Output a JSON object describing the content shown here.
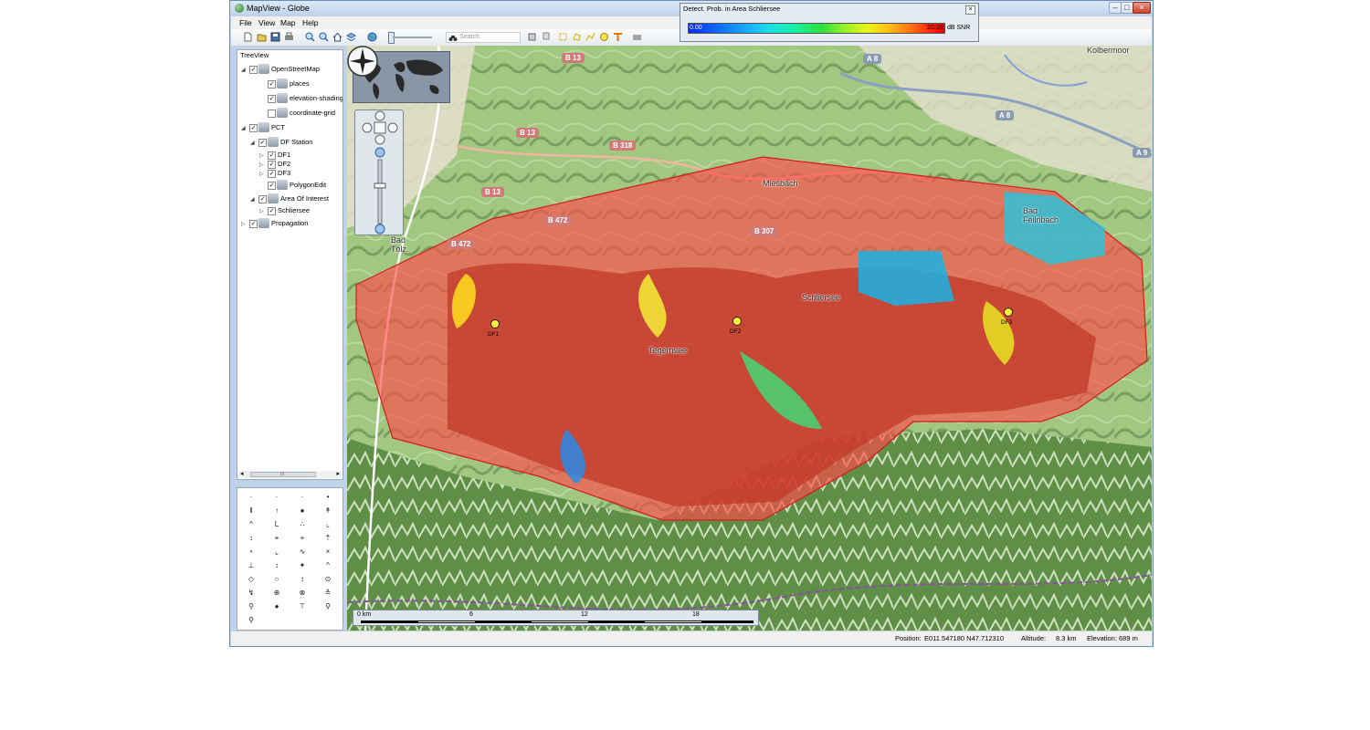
{
  "window": {
    "title": "MapView - Globe",
    "minimize": "–",
    "maximize": "□",
    "close": "×"
  },
  "menu": [
    "File",
    "View",
    "Map",
    "Help"
  ],
  "toolbar": {
    "search_placeholder": "Search"
  },
  "legend": {
    "title": "Detect. Prob. in Area Schliersee",
    "min": "0.00",
    "max": "20.00",
    "unit": "dB SNR",
    "close": "×"
  },
  "tree": {
    "title": "TreeView",
    "items": [
      {
        "label": "OpenStreetMap",
        "checked": true,
        "expander": "◢"
      },
      {
        "label": "places",
        "checked": true
      },
      {
        "label": "elevation-shading",
        "checked": true
      },
      {
        "label": "coordinate-grid",
        "checked": false
      },
      {
        "label": "PCT",
        "checked": true,
        "expander": "◢"
      },
      {
        "label": "DF Station",
        "checked": true,
        "expander": "◢"
      },
      {
        "label": "DF1",
        "checked": true,
        "expander": "▷"
      },
      {
        "label": "DF2",
        "checked": true,
        "expander": "▷"
      },
      {
        "label": "DF3",
        "checked": true,
        "expander": "▷"
      },
      {
        "label": "PolygonEdit",
        "checked": true
      },
      {
        "label": "Area Of Interest",
        "checked": true,
        "expander": "◢"
      },
      {
        "label": "Schliersee",
        "checked": true,
        "expander": "▷"
      },
      {
        "label": "Propagation",
        "checked": true,
        "expander": "▷"
      }
    ],
    "scroll_left": "◂",
    "scroll_right": "▸",
    "scroll_grip": "III"
  },
  "palette_symbols": [
    "·",
    "·",
    "·",
    "•",
    "‖",
    "↑",
    "●",
    "↟",
    "^",
    "L",
    "∴",
    "⌞",
    "↕",
    "⌖",
    "+",
    "⇡",
    "∘",
    "⌞",
    "∿",
    "×",
    "⊥",
    "↕",
    "✦",
    "^",
    "◇",
    "○",
    "↕",
    "⊙",
    "↯",
    "⊕",
    "⊗",
    "≚",
    "⚲",
    "●",
    "⊤",
    "⚲",
    "⚲"
  ],
  "map": {
    "towns": [
      "Bad Tölz",
      "Miesbach",
      "Schliersee",
      "Tegernsee",
      "Bad Feilnbach",
      "Kolbermoor"
    ],
    "roads": [
      "B 13",
      "B 13",
      "B 13",
      "B 318",
      "B 472",
      "B 472",
      "B 307",
      "A 8",
      "A 8",
      "A 9"
    ],
    "stations": [
      "DF1",
      "DF2",
      "DF3"
    ],
    "scale_labels": [
      "0 km",
      "6",
      "12",
      "18"
    ]
  },
  "status": {
    "position_label": "Position:",
    "position_value": "E011.547180 N47.712310",
    "altitude_label": "Altitude:",
    "altitude_value": "8.3 km",
    "elevation_label": "Elevation:",
    "elevation_value": "689 m"
  }
}
